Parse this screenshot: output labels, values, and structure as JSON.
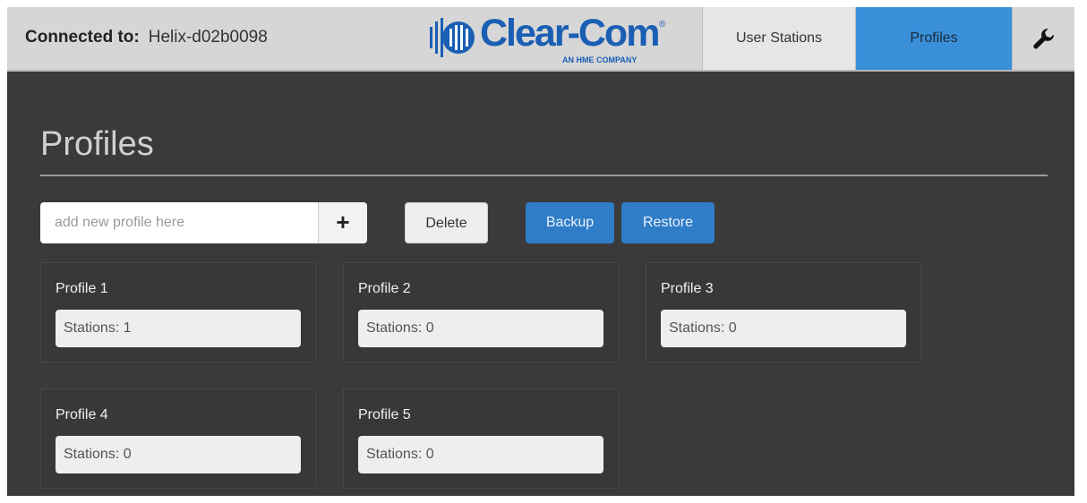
{
  "header": {
    "connected_label": "Connected to:",
    "connected_host": "Helix-d02b0098",
    "logo": {
      "wordmark": "Clear-Com",
      "registered": "®",
      "tagline": "AN HME COMPANY",
      "brand_color": "#1a5fb4"
    },
    "nav": {
      "user_stations": "User Stations",
      "profiles": "Profiles",
      "tools_icon": "wrench-icon",
      "active_color": "#3a8fd9"
    }
  },
  "page": {
    "title": "Profiles",
    "add_input": {
      "placeholder": "add new profile here",
      "value": ""
    },
    "add_button": "+",
    "delete_button": "Delete",
    "backup_button": "Backup",
    "restore_button": "Restore"
  },
  "profiles": [
    {
      "name": "Profile 1",
      "stations": "Stations: 1"
    },
    {
      "name": "Profile 2",
      "stations": "Stations: 0"
    },
    {
      "name": "Profile 3",
      "stations": "Stations: 0"
    },
    {
      "name": "Profile 4",
      "stations": "Stations: 0"
    },
    {
      "name": "Profile 5",
      "stations": "Stations: 0"
    }
  ]
}
